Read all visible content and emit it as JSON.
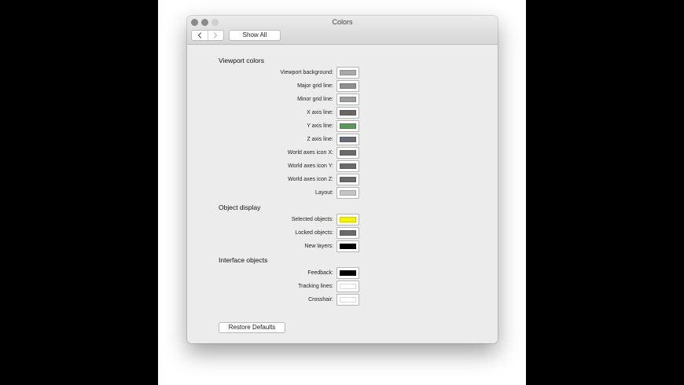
{
  "window": {
    "title": "Colors",
    "show_all_label": "Show All",
    "restore_label": "Restore Defaults"
  },
  "sections": [
    {
      "title": "Viewport colors",
      "rows": [
        {
          "label": "Viewport background:",
          "color": "#a8a8a8"
        },
        {
          "label": "Major grid line:",
          "color": "#8f8f8f"
        },
        {
          "label": "Minor grid line:",
          "color": "#9c9c9c"
        },
        {
          "label": "X axis line:",
          "color": "#6e6464"
        },
        {
          "label": "Y axis line:",
          "color": "#5a9a5a"
        },
        {
          "label": "Z axis line:",
          "color": "#6a6a78"
        },
        {
          "label": "World axes icon X:",
          "color": "#6a6a6a"
        },
        {
          "label": "World axes icon Y:",
          "color": "#6a6a6a"
        },
        {
          "label": "World axes icon Z:",
          "color": "#6a6a6a"
        },
        {
          "label": "Layout:",
          "color": "#c4c4c4"
        }
      ]
    },
    {
      "title": "Object display",
      "rows": [
        {
          "label": "Selected objects:",
          "color": "#f5f500"
        },
        {
          "label": "Locked objects:",
          "color": "#6a6a6a"
        },
        {
          "label": "New layers:",
          "color": "#000000"
        }
      ]
    },
    {
      "title": "Interface objects",
      "rows": [
        {
          "label": "Feedback:",
          "color": "#000000"
        },
        {
          "label": "Tracking lines:",
          "color": "#ffffff"
        },
        {
          "label": "Crosshair:",
          "color": "#ffffff"
        }
      ]
    }
  ]
}
